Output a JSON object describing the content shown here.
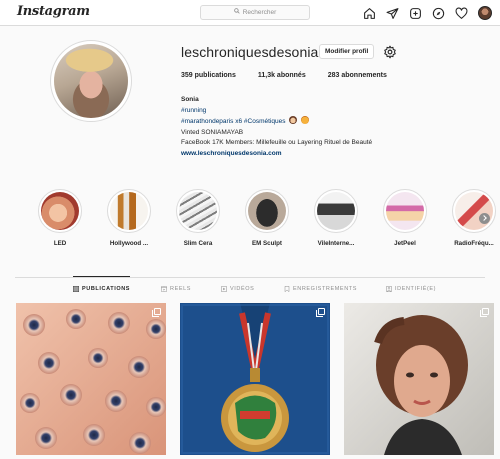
{
  "nav": {
    "logo": "Instagram",
    "search_placeholder": "Rechercher"
  },
  "profile": {
    "username": "leschroniquesdesonia",
    "edit_label": "Modifier profil",
    "stats": {
      "publications": "359 publications",
      "abonnes": "11,3k abonnés",
      "abonnements": "283 abonnements"
    },
    "bio": {
      "name": "Sonia",
      "line1": "#running",
      "line2_prefix": "#marathondeparis x6",
      "line2_tag": "#Cosmétiques",
      "line3": "Vinted SONIAMAYAB",
      "line4": "FaceBook 17K Members: Millefeuille ou Layering Rituel de Beauté",
      "website": "www.leschroniquesdesonia.com"
    }
  },
  "highlights": [
    {
      "label": "LED"
    },
    {
      "label": "Hollywood ..."
    },
    {
      "label": "Slim Cera"
    },
    {
      "label": "EM Sculpt"
    },
    {
      "label": "VileInterne..."
    },
    {
      "label": "JetPeel"
    },
    {
      "label": "RadioFréqu..."
    }
  ],
  "tabs": [
    {
      "label": "PUBLICATIONS",
      "icon": "grid-icon",
      "active": true
    },
    {
      "label": "REELS",
      "icon": "reels-icon"
    },
    {
      "label": "VIDÉOS",
      "icon": "video-icon"
    },
    {
      "label": "ENREGISTREMENTS",
      "icon": "bookmark-icon"
    },
    {
      "label": "IDENTIFIÉ(E)",
      "icon": "tag-icon"
    }
  ],
  "posts": [
    {
      "icon": "carousel-icon"
    },
    {
      "icon": "carousel-icon"
    },
    {
      "icon": "carousel-icon"
    }
  ],
  "colors": {
    "background": "#fafafa",
    "text": "#262626",
    "muted": "#8e8e8e",
    "border": "#dbdbdb",
    "link": "#00376b"
  }
}
